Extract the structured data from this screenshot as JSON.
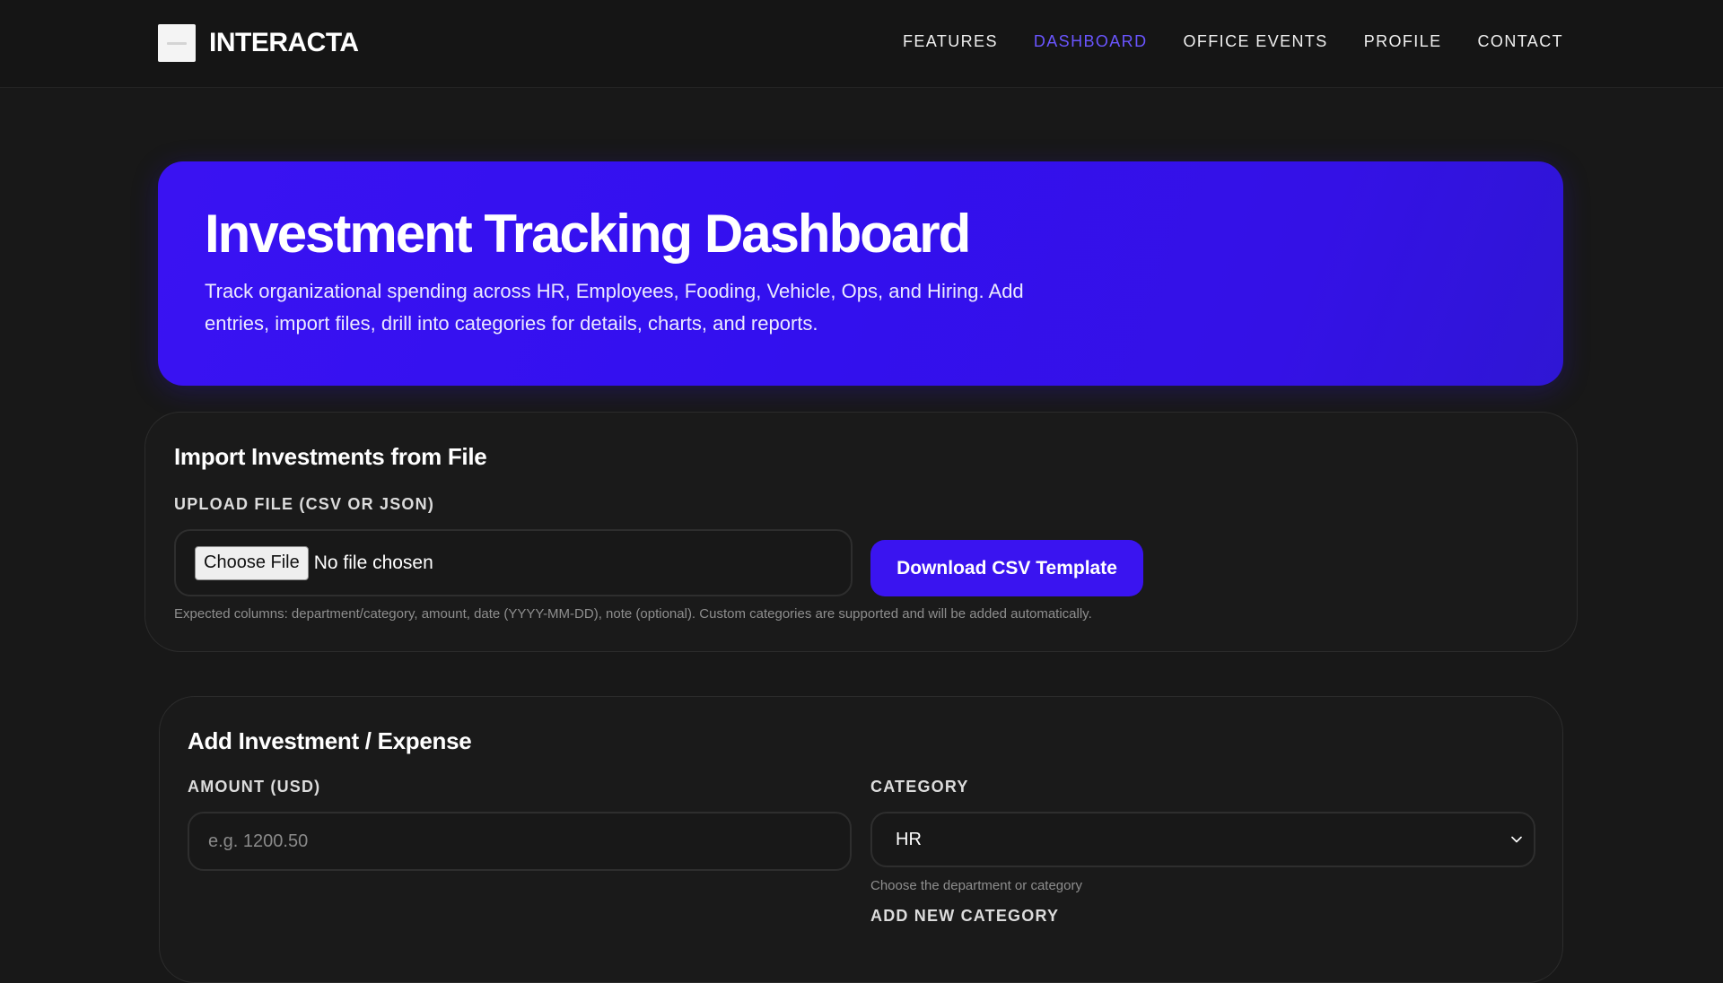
{
  "brand": {
    "name": "INTERACTA"
  },
  "nav": {
    "items": [
      {
        "label": "FEATURES"
      },
      {
        "label": "DASHBOARD",
        "active": true
      },
      {
        "label": "OFFICE EVENTS"
      },
      {
        "label": "PROFILE"
      },
      {
        "label": "CONTACT"
      }
    ]
  },
  "hero": {
    "title": "Investment Tracking Dashboard",
    "subtitle": "Track organizational spending across HR, Employees, Fooding, Vehicle, Ops, and Hiring. Add entries, import files, drill into categories for details, charts, and reports."
  },
  "import": {
    "title": "Import Investments from File",
    "upload_label": "UPLOAD FILE (CSV OR JSON)",
    "choose_button": "Choose File",
    "file_status": "No file chosen",
    "download_button": "Download CSV Template",
    "hint": "Expected columns: department/category, amount, date (YYYY-MM-DD), note (optional). Custom categories are supported and will be added automatically."
  },
  "add": {
    "title": "Add Investment / Expense",
    "amount_label": "AMOUNT (USD)",
    "amount_placeholder": "e.g. 1200.50",
    "category_label": "CATEGORY",
    "category_value": "HR",
    "category_hint": "Choose the department or category",
    "new_category_label": "ADD NEW CATEGORY"
  },
  "colors": {
    "accent": "#3a14f0",
    "nav_active": "#6a55ff",
    "background": "#181818"
  }
}
